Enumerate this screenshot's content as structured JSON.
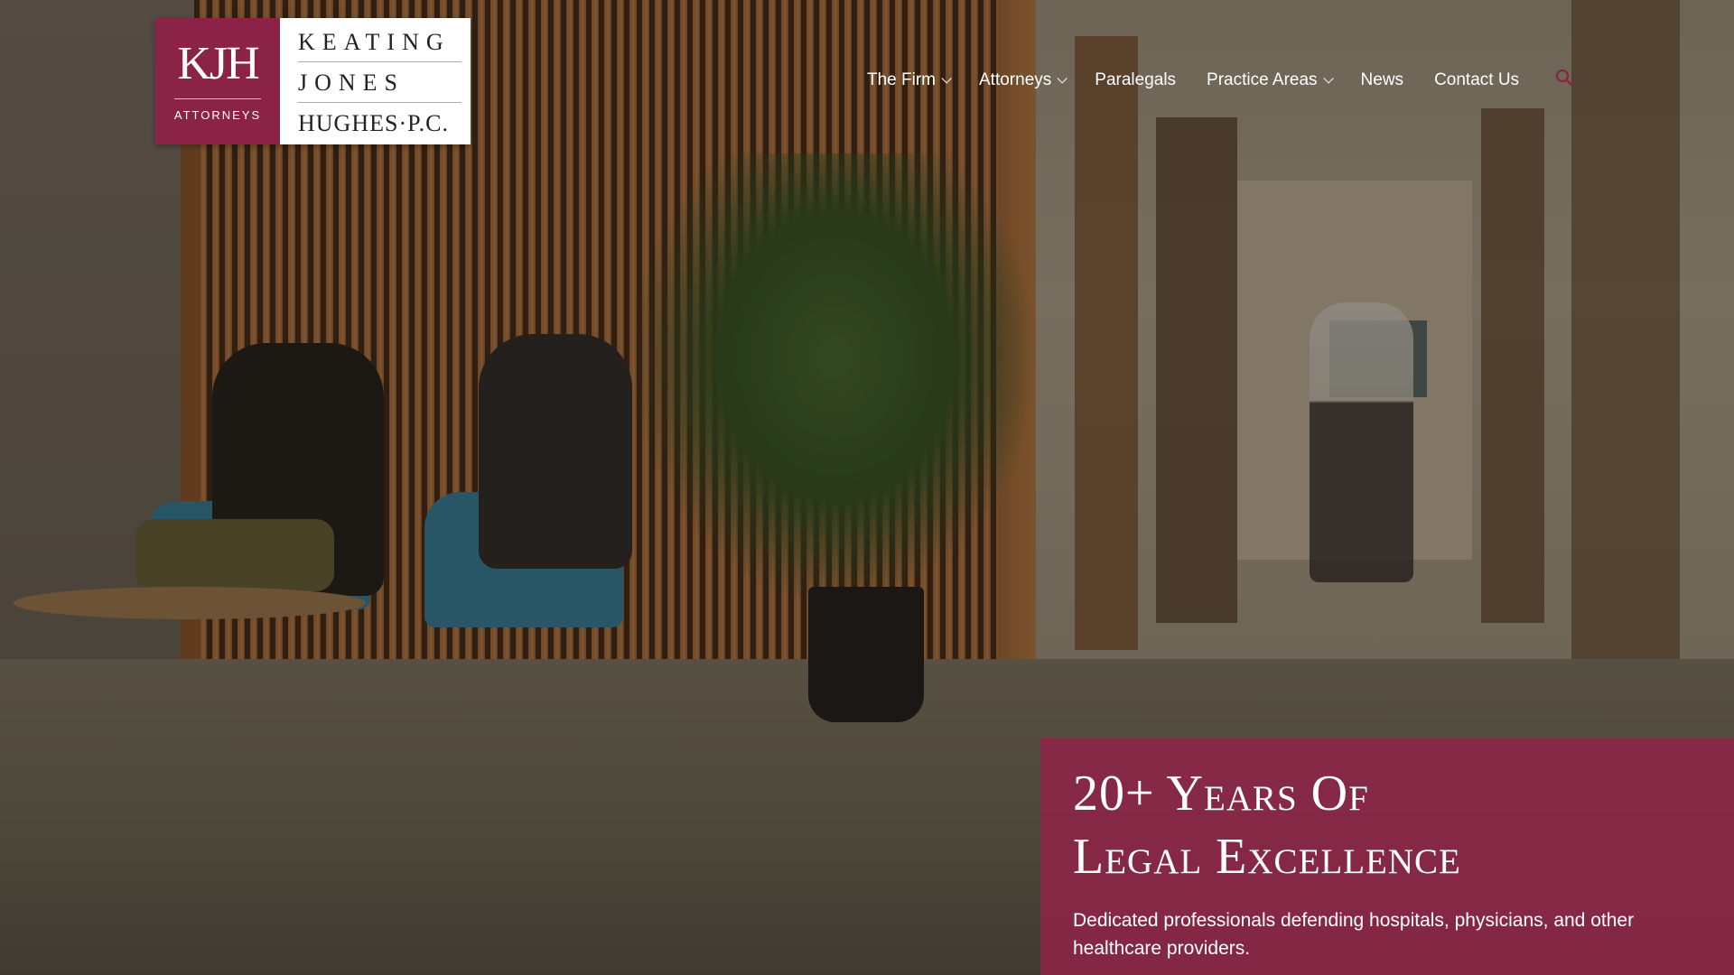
{
  "logo": {
    "initials": "KJH",
    "tagline": "ATTORNEYS",
    "name_lines": [
      "KEATING",
      "JONES",
      "HUGHES·P.C."
    ]
  },
  "nav": {
    "items": [
      {
        "label": "The Firm",
        "dropdown": true
      },
      {
        "label": "Attorneys",
        "dropdown": true
      },
      {
        "label": "Paralegals",
        "dropdown": false
      },
      {
        "label": "Practice Areas",
        "dropdown": true
      },
      {
        "label": "News",
        "dropdown": false
      },
      {
        "label": "Contact Us",
        "dropdown": false
      }
    ],
    "search_icon": "search-icon"
  },
  "hero": {
    "headline_line1": "20+ Years Of",
    "headline_line2": "Legal Excellence",
    "subtext": "Dedicated professionals defending hospitals, physicians, and other healthcare providers."
  },
  "colors": {
    "brand": "#8a2346",
    "overlay": "#8d2448",
    "nav_text": "#ffffff"
  }
}
